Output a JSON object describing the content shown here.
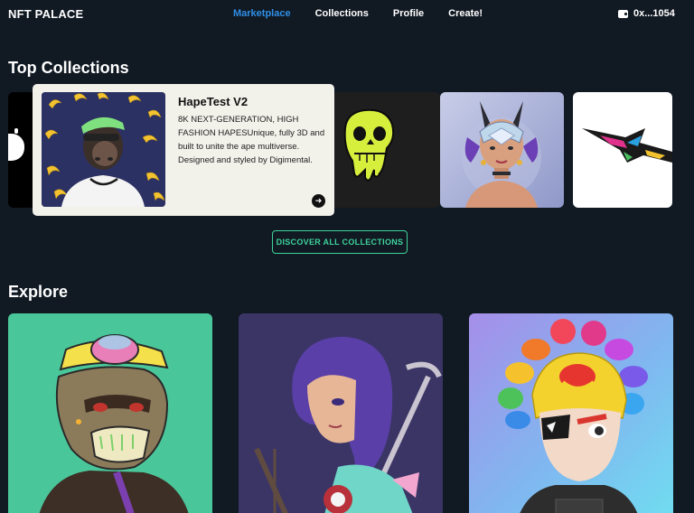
{
  "nav": {
    "logo": "NFT PALACE",
    "links": [
      "Marketplace",
      "Collections",
      "Profile",
      "Create!"
    ],
    "active_link": "Marketplace",
    "wallet_address": "0x...1054"
  },
  "top_collections": {
    "title": "Top Collections",
    "featured": {
      "name": "HapeTest V2",
      "description": "8K NEXT-GENERATION, HIGH FASHION HAPESUnique, fully 3D and built to unite the ape multiverse. Designed and styled by Digimental."
    },
    "discover_button": "DISCOVER ALL COLLECTIONS"
  },
  "explore": {
    "title": "Explore"
  },
  "colors": {
    "background": "#111923",
    "accent_blue": "#2f8fe6",
    "accent_green": "#3dd39b"
  }
}
